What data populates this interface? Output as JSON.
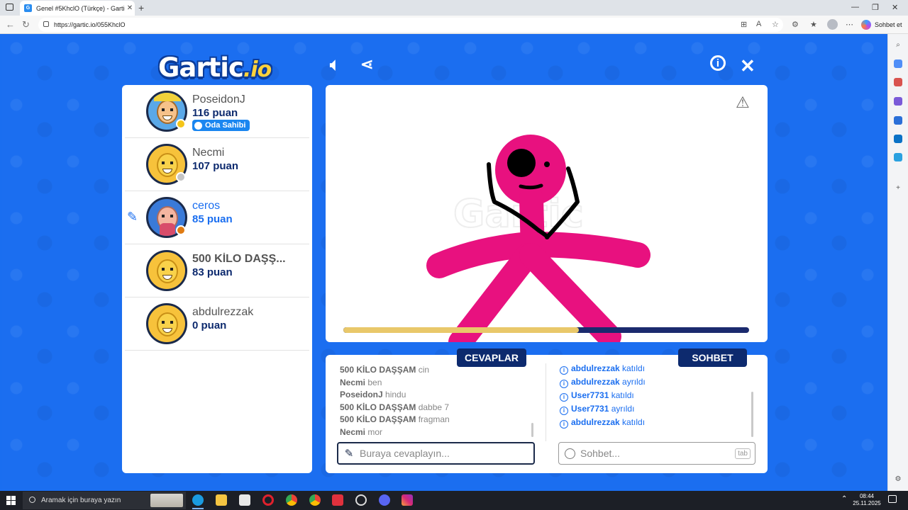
{
  "browser": {
    "tab_title": "Genel #5KhclO (Türkçe) - Gartic.io",
    "url": "https://gartic.io/055KhclO",
    "copilot_label": "Sohbet et"
  },
  "game": {
    "logo": "Gartic",
    "logo_suffix": ".io",
    "players": [
      {
        "name": "PoseidonJ",
        "points": "116 puan",
        "badge": "Oda Sahibi",
        "status_color": "#f5c518"
      },
      {
        "name": "Necmi",
        "points": "107 puan",
        "status_color": "#c4c4c4"
      },
      {
        "name": "ceros",
        "points": "85 puan",
        "status_color": "#e07b12",
        "drawing": true
      },
      {
        "name": "500 KİLO DAŞŞ...",
        "points": "83 puan"
      },
      {
        "name": "abdulrezzak",
        "points": "0 puan"
      }
    ],
    "timer_progress": 0.58,
    "tabs": {
      "answers": "CEVAPLAR",
      "chat": "SOHBET"
    },
    "answers": [
      {
        "user": "500 KİLO DAŞŞAM",
        "text": "cin"
      },
      {
        "user": "Necmi",
        "text": "ben"
      },
      {
        "user": "PoseidonJ",
        "text": "hindu"
      },
      {
        "user": "500 KİLO DAŞŞAM",
        "text": "dabbe 7"
      },
      {
        "user": "500 KİLO DAŞŞAM",
        "text": "fragman"
      },
      {
        "user": "Necmi",
        "text": "mor"
      }
    ],
    "system_messages": [
      {
        "user": "abdulrezzak",
        "text": "katıldı"
      },
      {
        "user": "abdulrezzak",
        "text": "ayrıldı"
      },
      {
        "user": "User7731",
        "text": "katıldı"
      },
      {
        "user": "User7731",
        "text": "ayrıldı"
      },
      {
        "user": "abdulrezzak",
        "text": "katıldı"
      }
    ],
    "answer_placeholder": "Buraya cevaplayın...",
    "chat_placeholder": "Sohbet...",
    "tab_hint": "tab"
  },
  "taskbar": {
    "search_placeholder": "Aramak için buraya yazın",
    "time": "08:44",
    "date": "25.11.2025"
  },
  "colors": {
    "brand_blue": "#1b6ef0",
    "navy": "#0d2a6e",
    "drawing_pink": "#e8117f"
  }
}
